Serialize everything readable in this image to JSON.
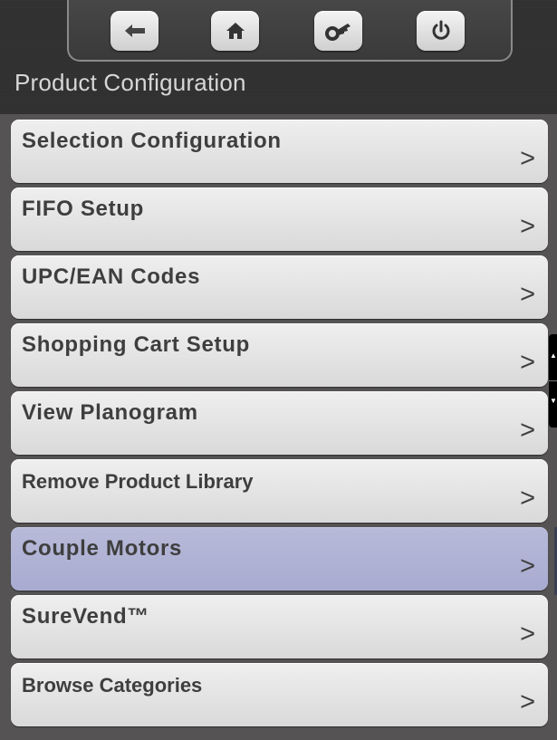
{
  "header": {
    "title": "Product Configuration",
    "buttons": [
      {
        "icon": "back-arrow-icon"
      },
      {
        "icon": "home-icon"
      },
      {
        "icon": "key-icon"
      },
      {
        "icon": "power-icon"
      }
    ]
  },
  "menu": {
    "items": [
      {
        "label": "Selection Configuration",
        "arrow": ">"
      },
      {
        "label": "FIFO Setup",
        "arrow": ">"
      },
      {
        "label": "UPC/EAN Codes",
        "arrow": ">"
      },
      {
        "label": "Shopping Cart Setup",
        "arrow": ">"
      },
      {
        "label": "View Planogram",
        "arrow": ">"
      },
      {
        "label": "Remove Product Library",
        "arrow": ">"
      },
      {
        "label": "Couple Motors",
        "arrow": ">"
      },
      {
        "label": "SureVend™",
        "arrow": ">"
      },
      {
        "label": "Browse Categories",
        "arrow": ">"
      }
    ],
    "selected_item": "Couple Motors"
  },
  "scroll_control": {
    "up_icon": "scroll-up-icon",
    "down_icon": "scroll-down-icon"
  },
  "colors": {
    "background": "#303030",
    "menu_area": "#555353",
    "menu_item": "#e2e2e2",
    "selected_item": "#adafd3",
    "text": "#3e3e3e",
    "title": "#d7d7d7"
  }
}
